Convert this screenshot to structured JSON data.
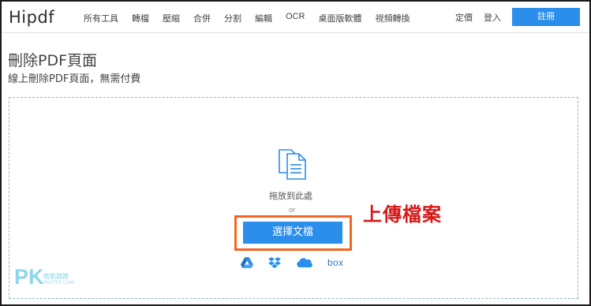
{
  "header": {
    "logo": "Hipdf",
    "nav": [
      "所有工具",
      "轉檔",
      "壓縮",
      "合併",
      "分割",
      "編輯",
      "OCR",
      "桌面版軟體",
      "視頻轉換"
    ],
    "pricing": "定價",
    "login": "登入",
    "signup": "註冊"
  },
  "page": {
    "title": "刪除PDF頁面",
    "subtitle": "線上刪除PDF頁面，無需付費"
  },
  "upload": {
    "drag_text": "拖放到此處",
    "or_text": "or",
    "choose_button": "選擇文檔",
    "annotation": "上傳檔案",
    "cloud_sources": [
      "google-drive",
      "dropbox",
      "onedrive",
      "box"
    ],
    "box_label": "box"
  },
  "watermark": {
    "logo": "PK",
    "line1": "痞凱踏踏",
    "line2": "PKSTEP.COM"
  },
  "colors": {
    "accent": "#2b8eea",
    "highlight": "#f26522",
    "annotation": "#d81818"
  }
}
